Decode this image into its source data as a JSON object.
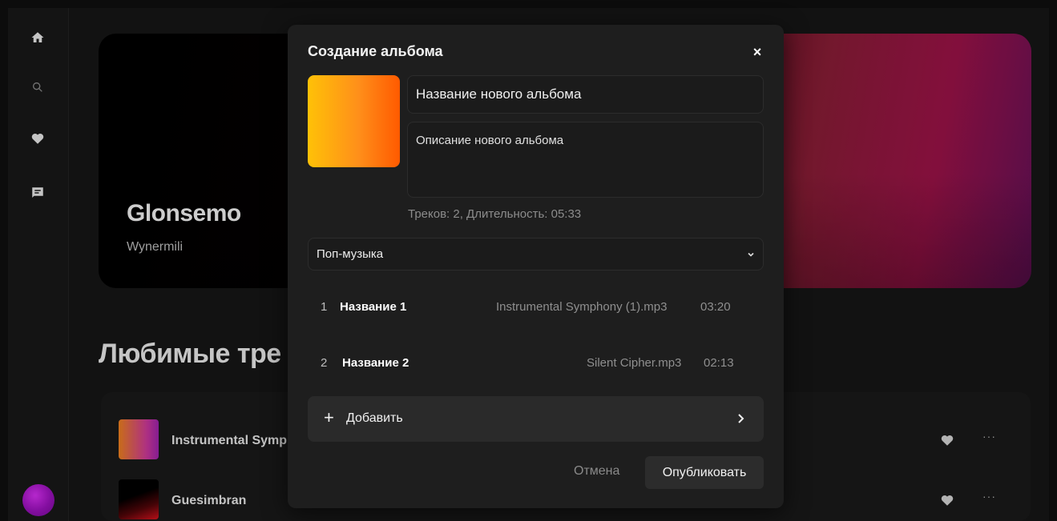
{
  "sidebar": {
    "icons": [
      "home-icon",
      "search-icon",
      "heart-icon",
      "chat-icon"
    ]
  },
  "hero": {
    "title": "Glonsemo",
    "subtitle": "Wynermili"
  },
  "favorites": {
    "title": "Любимые тре",
    "items": [
      {
        "title": "Instrumental Symp"
      },
      {
        "title": "Guesimbran"
      }
    ],
    "more_label": "···"
  },
  "modal": {
    "title": "Создание альбома",
    "close_label": "×",
    "name_value": "Название нового альбома",
    "description_value": "Описание нового альбома",
    "stats": "Треков: 2, Длительность: 05:33",
    "genre": "Поп-музыка",
    "tracks": [
      {
        "num": "1",
        "name": "Название 1",
        "file": "Instrumental Symphony (1).mp3",
        "duration": "03:20"
      },
      {
        "num": "2",
        "name": "Название 2",
        "file": "Silent Cipher.mp3",
        "duration": "02:13"
      }
    ],
    "add_plus": "+",
    "add_label": "Добавить",
    "cancel_label": "Отмена",
    "publish_label": "Опубликовать"
  },
  "colors": {
    "cover_start": "#ffc107",
    "cover_end": "#ff5a00",
    "avatar": "#c02ad8"
  }
}
